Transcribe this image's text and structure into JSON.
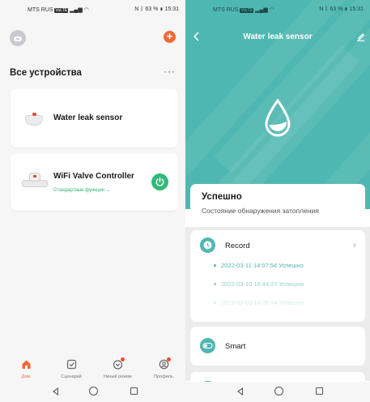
{
  "status_bar": {
    "carrier": "MTS RUS",
    "network_badge": "VoLTE",
    "battery": "63 %",
    "time": "15:31"
  },
  "home": {
    "section_title": "Все устройства",
    "more_label": "···",
    "add_label": "+",
    "devices": [
      {
        "name": "Water leak sensor",
        "icon": "water-leak-sensor-image"
      },
      {
        "name": "WiFi Valve Controller",
        "subtitle": "Стандартные функции ⌄",
        "icon": "valve-image"
      }
    ],
    "tabs": [
      {
        "label": "Дом",
        "icon": "home-icon",
        "active": true
      },
      {
        "label": "Сценарий",
        "icon": "checkbox-icon"
      },
      {
        "label": "Умный режим",
        "icon": "smart-icon",
        "badge": true
      },
      {
        "label": "Профиль",
        "icon": "profile-icon",
        "badge": true
      }
    ]
  },
  "detail": {
    "title": "Water leak sensor",
    "status_title": "Успешно",
    "status_desc": "Состояние обнаружения затопления",
    "record_title": "Record",
    "records": [
      "2022-03-11 14:07:54 Успешно",
      "2022-03-10 16:44:27 Успешно",
      "2022-03-09 14:05:44 Успешно"
    ],
    "smart_title": "Smart"
  },
  "colors": {
    "accent_orange": "#f26a3a",
    "teal": "#4fb7b1",
    "green": "#33b978"
  }
}
